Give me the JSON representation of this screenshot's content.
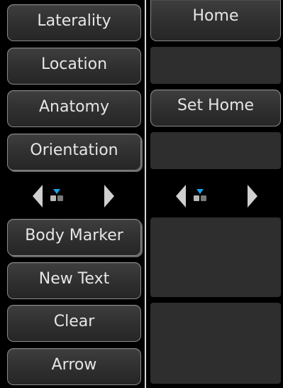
{
  "left_column": {
    "buttons_top": [
      {
        "label": "Laterality"
      },
      {
        "label": "Location"
      },
      {
        "label": "Anatomy"
      },
      {
        "label": "Orientation"
      }
    ],
    "buttons_bottom": [
      {
        "label": "Body Marker"
      },
      {
        "label": "New Text"
      },
      {
        "label": "Clear"
      },
      {
        "label": "Arrow"
      }
    ],
    "page_indicator": {
      "current_page": 1,
      "total_pages": 2
    }
  },
  "right_column": {
    "home_label": "Home",
    "set_home_label": "Set Home",
    "page_indicator": {
      "current_page": 1,
      "total_pages": 2
    }
  },
  "colors": {
    "accent": "#1aa3e8",
    "button_bg": "#333333",
    "button_border": "#8a8a8a",
    "text": "#e6e6e6",
    "background": "#000000"
  },
  "icons": [
    "page-prev-icon",
    "page-next-icon",
    "page-indicator-icon"
  ]
}
